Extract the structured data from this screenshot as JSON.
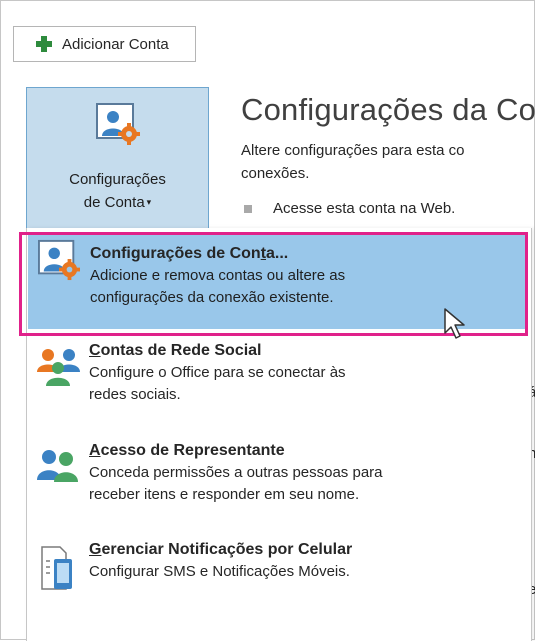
{
  "toolbar": {
    "add_account_label": "Adicionar Conta"
  },
  "account_settings_button": {
    "label_line1": "Configurações",
    "label_line2": "de Conta",
    "caret": "▾"
  },
  "section": {
    "title": "Configurações da Co",
    "desc_line1": "Altere configurações para esta co",
    "desc_line2": "conexões.",
    "web_link": "Acesse esta conta na Web."
  },
  "background_fragments": [
    "á",
    "n",
    "e"
  ],
  "menu": {
    "items": [
      {
        "title_pre": "Configurações de Con",
        "title_ul": "t",
        "title_post": "a...",
        "desc_line1": "Adicione e remova contas ou altere as",
        "desc_line2": "configurações da conexão existente.",
        "icon": "account-settings-icon"
      },
      {
        "title_ul": "C",
        "title_post": "ontas de Rede Social",
        "desc_line1": "Configure o Office para se conectar às",
        "desc_line2": "redes sociais.",
        "icon": "social-network-icon"
      },
      {
        "title_ul": "A",
        "title_post": "cesso de Representante",
        "desc_line1": "Conceda permissões a outras pessoas para",
        "desc_line2": "receber itens e responder em seu nome.",
        "icon": "delegate-access-icon"
      },
      {
        "title_ul": "G",
        "title_post": "erenciar Notificações por Celular",
        "desc_line1": "Configurar SMS e Notificações Móveis.",
        "icon": "mobile-notification-icon"
      }
    ]
  },
  "colors": {
    "selected_bg": "#99c7ea",
    "highlight_border": "#e0218a",
    "button_bg": "#c5dced",
    "plus_green": "#2e8b3d"
  }
}
